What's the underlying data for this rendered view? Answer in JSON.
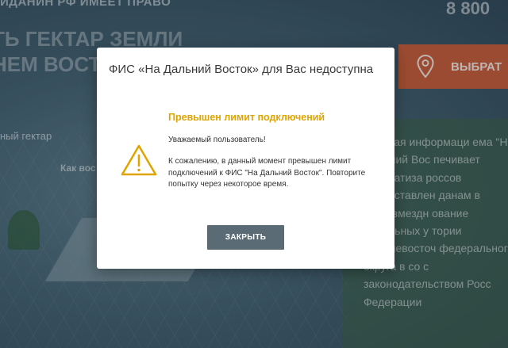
{
  "background": {
    "header_text": "ИДАНИН РФ ИМЕЕТ ПРАВО",
    "headline_line1": "ТЬ ГЕКТАР ЗЕМЛИ",
    "headline_line2": "НЕМ ВОСТ",
    "phone": "8 800",
    "choose_button_label": "ВЫБРАТ",
    "one_hectare_label": "ный гектар",
    "how_to_label": "Как вос",
    "info_text": "вальная информаци ема \"На Дальний Вос печивает автоматиза россов предоставлен данам в безвозмездн ование земельных у тории Дальневосточ федерального округа в со с законодательством Росс Федерации"
  },
  "modal": {
    "title": "ФИС «На Дальний Восток» для Вас недоступна",
    "heading": "Превышен лимит подключений",
    "greeting": "Уважаемый пользователь!",
    "message": "К сожалению, в данный момент превышен лимит подключений к ФИС \"На Дальний Восток\". Повторите попытку через некоторое время.",
    "close_label": "ЗАКРЫТЬ",
    "warning_icon": "warning-triangle-icon",
    "accent_color": "#e0a400",
    "button_color": "#5b6b75"
  }
}
